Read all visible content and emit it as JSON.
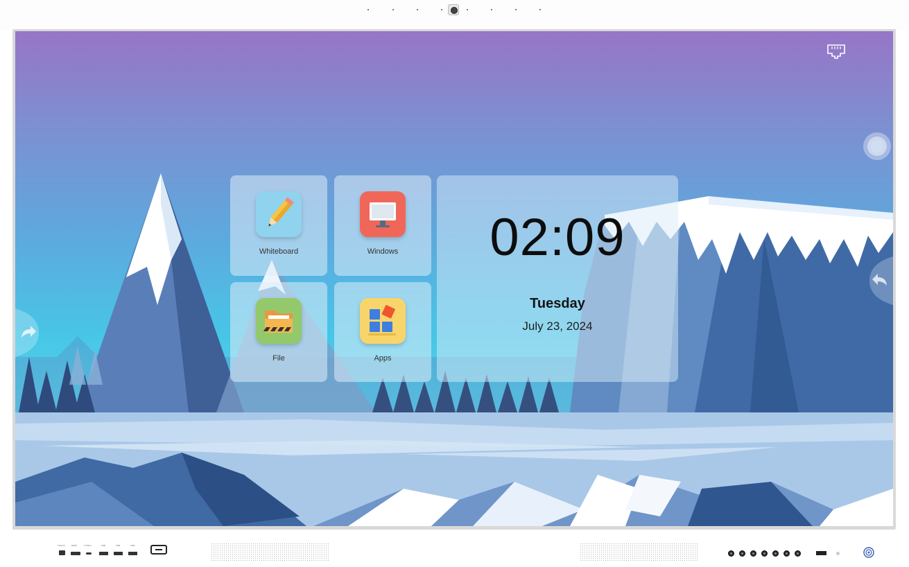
{
  "home": {
    "tiles": [
      {
        "label": "Whiteboard",
        "icon": "whiteboard-icon"
      },
      {
        "label": "Windows",
        "icon": "windows-pc-icon"
      },
      {
        "label": "File",
        "icon": "file-folder-icon"
      },
      {
        "label": "Apps",
        "icon": "apps-icon"
      }
    ]
  },
  "clock": {
    "time": "02:09",
    "day": "Tuesday",
    "date": "July 23, 2024"
  },
  "status": {
    "network_icon": "ethernet-icon"
  },
  "side_controls": {
    "assistive_ball_icon": "floating-ball-icon",
    "left_icon": "forward-arrow-icon",
    "right_icon": "back-arrow-icon"
  },
  "hardware": {
    "port_labels": [
      "TOUCH",
      "HDMI",
      "TYPE-C",
      "USB",
      "USB",
      "USB"
    ]
  },
  "colors": {
    "sky_top": "#9775c7",
    "sky_bottom": "#47c6e7",
    "tile_bg": "#dfecf8",
    "windows_icon_bg": "#f0675a",
    "file_icon_bg": "#94c96b",
    "apps_icon_bg": "#f7d56a",
    "whiteboard_icon_bg": "#8fd3ee"
  }
}
